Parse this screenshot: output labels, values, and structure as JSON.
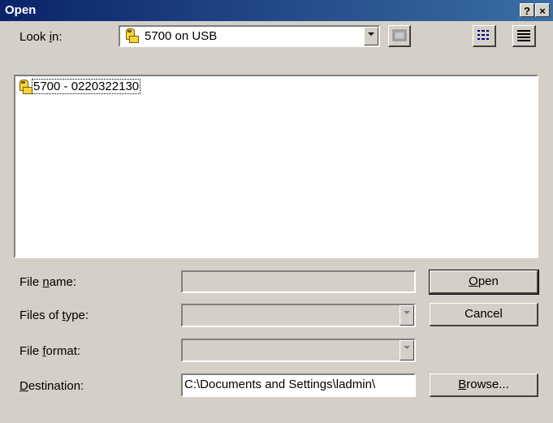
{
  "window": {
    "title": "Open",
    "help_label": "?",
    "close_label": "×"
  },
  "lookin": {
    "label_pre": "Look ",
    "label_key": "i",
    "label_post": "n:",
    "value": "5700 on USB"
  },
  "files": [
    {
      "name": "5700 - 0220322130"
    }
  ],
  "fields": {
    "filename": {
      "label_pre": "File ",
      "label_key": "n",
      "label_post": "ame:",
      "value": ""
    },
    "filetype": {
      "label_pre": "Files of ",
      "label_key": "t",
      "label_post": "ype:",
      "value": ""
    },
    "fileformat": {
      "label_pre": "File ",
      "label_key": "f",
      "label_post": "ormat:",
      "value": ""
    },
    "destination": {
      "label_pre": "",
      "label_key": "D",
      "label_post": "estination:",
      "value": "C:\\Documents and Settings\\ladmin\\"
    }
  },
  "buttons": {
    "open_key": "O",
    "open_rest": "pen",
    "cancel": "Cancel",
    "browse_key": "B",
    "browse_rest": "rowse..."
  },
  "icons": {
    "usb": "usb-drive-icon",
    "up": "up-folder-icon",
    "list": "list-view-icon",
    "details": "details-view-icon"
  }
}
